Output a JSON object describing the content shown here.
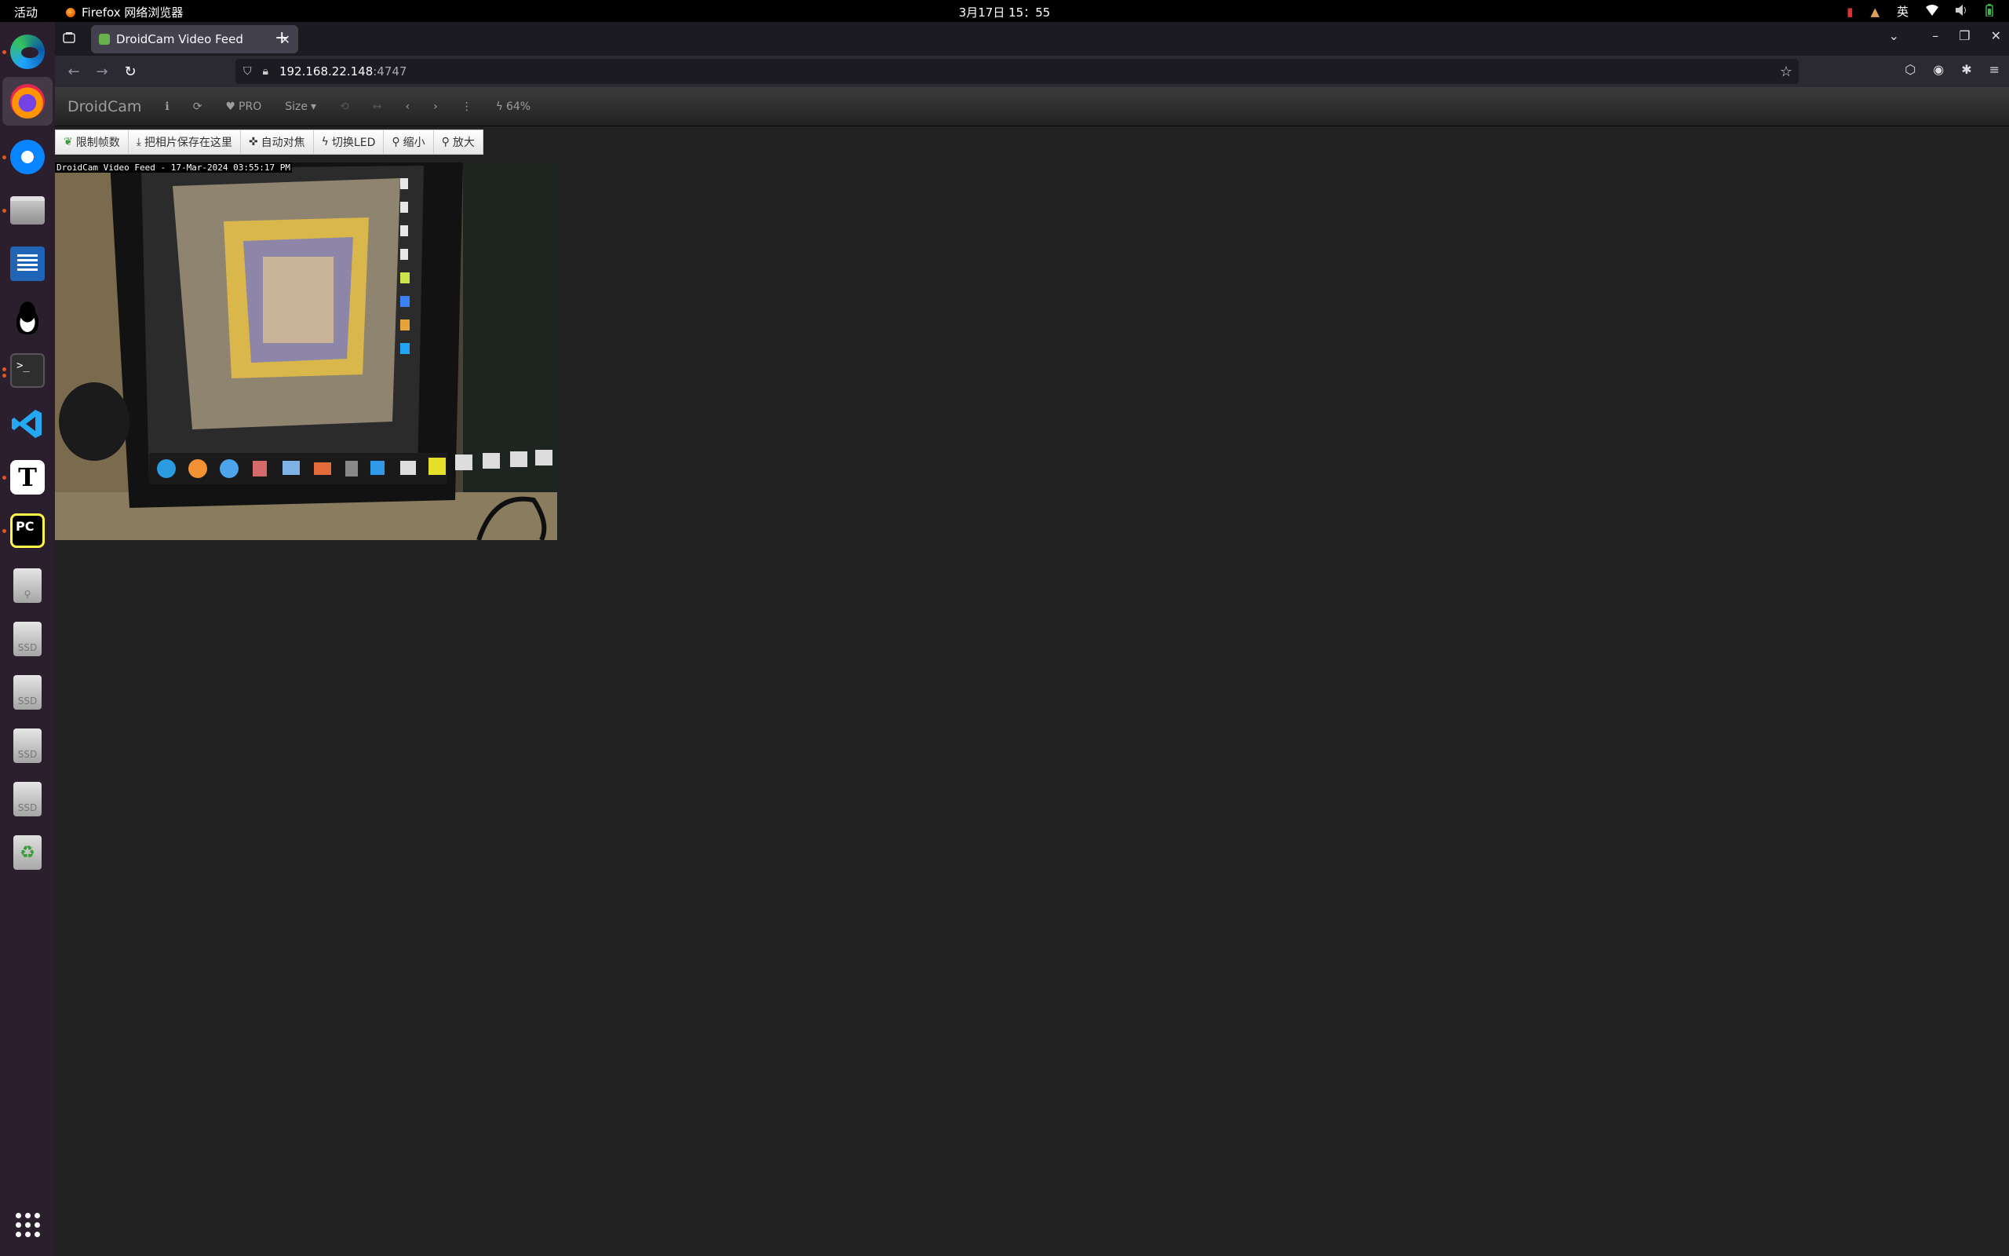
{
  "topbar": {
    "activities": "活动",
    "app_name": "Firefox 网络浏览器",
    "clock": "3月17日 15：55",
    "input_method": "英"
  },
  "dock": {
    "items": [
      "edge-icon",
      "firefox-icon",
      "thunderbird-icon",
      "files-icon",
      "writer-icon",
      "qq-icon",
      "terminal-icon",
      "vscode-icon",
      "typora-icon",
      "pycharm-icon",
      "usb-drive-icon",
      "ssd-icon",
      "ssd-icon",
      "ssd-icon",
      "ssd-icon",
      "trash-icon",
      "show-apps-icon"
    ],
    "pycharm_label": "PC",
    "ssd_label": "SSD",
    "typora_label": "T",
    "terminal_label": ">_"
  },
  "browser": {
    "tab_title": "DroidCam Video Feed",
    "url_host": "192.168.22.148",
    "url_port": ":4747"
  },
  "droidcam": {
    "brand": "DroidCam",
    "pro_label": "PRO",
    "size_label": "Size",
    "battery": "64%",
    "toolbar": {
      "limit_fps": "限制帧数",
      "save_photo": "把相片保存在这里",
      "autofocus": "自动对焦",
      "toggle_led": "切换LED",
      "zoom_out": "缩小",
      "zoom_in": "放大"
    },
    "video_overlay": "DroidCam Video Feed - 17-Mar-2024 03:55:17 PM"
  },
  "colors": {
    "accent": "#e95420",
    "page_bg": "#222222",
    "dock_bg": "#2b1f2e"
  }
}
